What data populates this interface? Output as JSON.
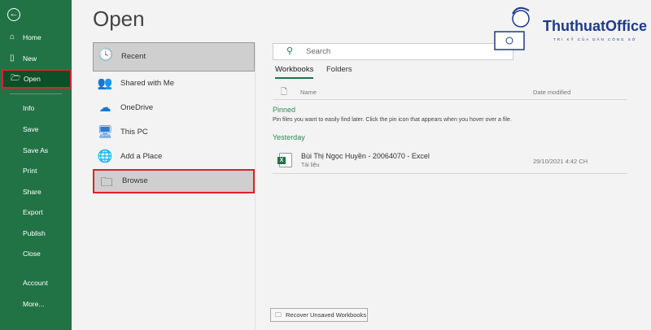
{
  "sidebar": {
    "items": [
      {
        "label": "Home",
        "icon": "home-icon"
      },
      {
        "label": "New",
        "icon": "new-file-icon"
      },
      {
        "label": "Open",
        "icon": "folder-open-icon"
      },
      {
        "label": "Info"
      },
      {
        "label": "Save"
      },
      {
        "label": "Save As"
      },
      {
        "label": "Print"
      },
      {
        "label": "Share"
      },
      {
        "label": "Export"
      },
      {
        "label": "Publish"
      },
      {
        "label": "Close"
      },
      {
        "label": "Account"
      },
      {
        "label": "More..."
      }
    ]
  },
  "title": "Open",
  "places": [
    {
      "label": "Recent"
    },
    {
      "label": "Shared with Me"
    },
    {
      "label": "OneDrive"
    },
    {
      "label": "This PC"
    },
    {
      "label": "Add a Place"
    },
    {
      "label": "Browse"
    }
  ],
  "search": {
    "placeholder": "Search"
  },
  "tabs": [
    "Workbooks",
    "Folders"
  ],
  "columns": {
    "name": "Name",
    "date": "Date modified"
  },
  "pinned": {
    "heading": "Pinned",
    "hint": "Pin files you want to easily find later. Click the pin icon that appears when you hover over a file."
  },
  "yesterday": {
    "heading": "Yesterday",
    "files": [
      {
        "name": "Bùi Thị Ngọc Huyền - 20064070 - Excel",
        "location": "Tài liệu",
        "date": "29/10/2021 4:42 CH"
      }
    ]
  },
  "recover_label": "Recover Unsaved Workbooks",
  "logo": {
    "name": "ThuthuatOffice",
    "tagline": "TRI KỶ CỦA DÂN CÔNG SỞ"
  }
}
